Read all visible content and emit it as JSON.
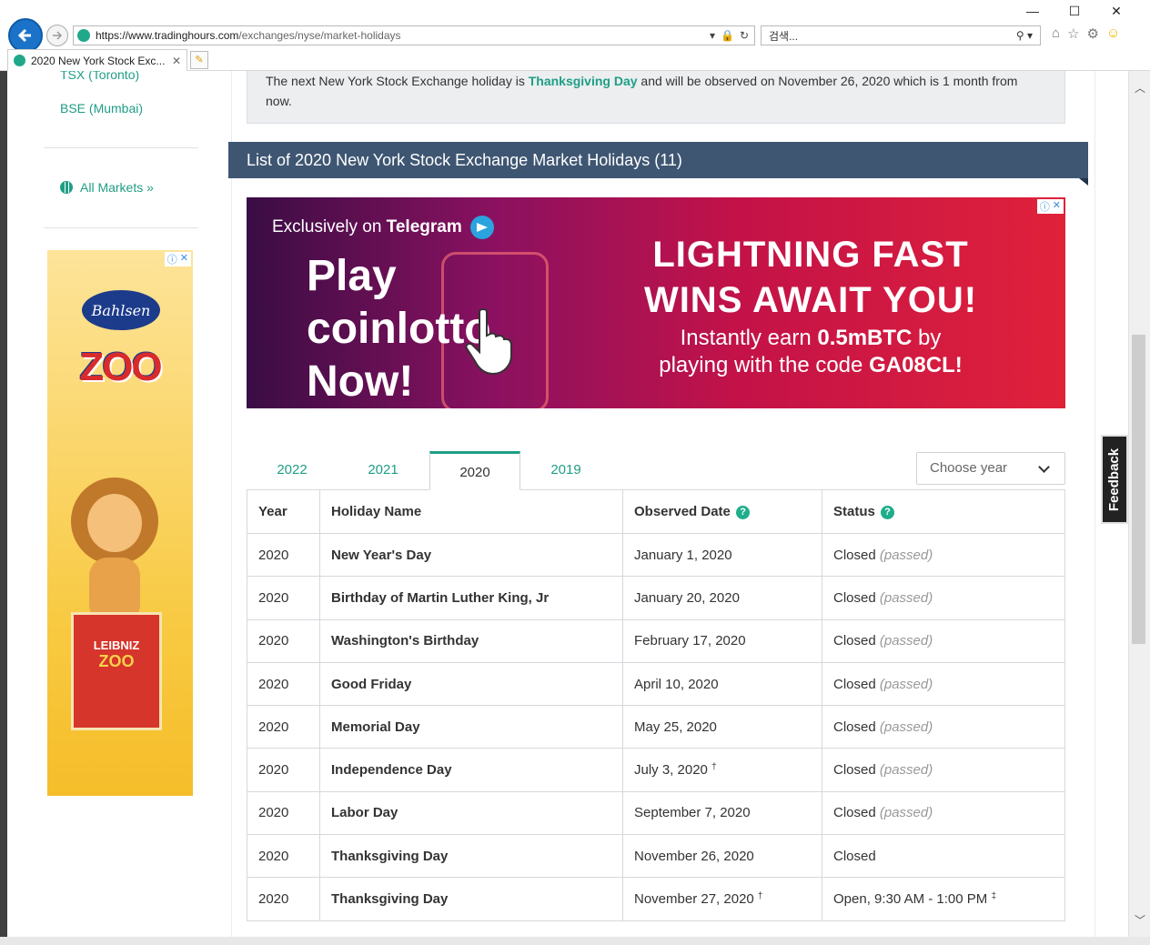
{
  "browser": {
    "url_host": "https://www.tradinghours.com",
    "url_path": "/exchanges/nyse/market-holidays",
    "search_placeholder": "검색...",
    "tab_title": "2020 New York Stock Exc...",
    "tab_close": "✕"
  },
  "sidebar": {
    "links": [
      "TSX (Toronto)",
      "BSE (Mumbai)"
    ],
    "all_markets": "All Markets »"
  },
  "ads": {
    "vertical": {
      "brand": "Bahlsen",
      "product": "ZOO",
      "box_brand": "LEIBNIZ",
      "box_product": "ZOO"
    },
    "banner": {
      "exclusive_prefix": "Exclusively on",
      "exclusive_brand": "Telegram",
      "play_line1": "Play",
      "play_line2": "coinlotto",
      "play_line3": "Now!",
      "headline_line1": "LIGHTNING FAST",
      "headline_line2": "WINS AWAIT YOU!",
      "sub_line1_prefix": "Instantly earn",
      "sub_line1_bold": "0.5mBTC",
      "sub_line1_suffix": "by",
      "sub_line2_prefix": "playing with the code",
      "sub_line2_bold": "GA08CL!"
    }
  },
  "notice": {
    "prefix": "The next New York Stock Exchange holiday is",
    "holiday": "Thanksgiving Day",
    "suffix": "and will be observed on November 26, 2020 which is 1 month from now."
  },
  "list_title": "List of 2020 New York Stock Exchange Market Holidays (11)",
  "year_tabs": [
    "2022",
    "2021",
    "2020",
    "2019"
  ],
  "year_select_placeholder": "Choose year",
  "table": {
    "headers": [
      "Year",
      "Holiday Name",
      "Observed Date",
      "Status"
    ],
    "rows": [
      {
        "year": "2020",
        "name": "New Year's Day",
        "date": "January 1, 2020",
        "date_mark": "",
        "status": "Closed",
        "note": "(passed)",
        "status_mark": ""
      },
      {
        "year": "2020",
        "name": "Birthday of Martin Luther King, Jr",
        "date": "January 20, 2020",
        "date_mark": "",
        "status": "Closed",
        "note": "(passed)",
        "status_mark": ""
      },
      {
        "year": "2020",
        "name": "Washington's Birthday",
        "date": "February 17, 2020",
        "date_mark": "",
        "status": "Closed",
        "note": "(passed)",
        "status_mark": ""
      },
      {
        "year": "2020",
        "name": "Good Friday",
        "date": "April 10, 2020",
        "date_mark": "",
        "status": "Closed",
        "note": "(passed)",
        "status_mark": ""
      },
      {
        "year": "2020",
        "name": "Memorial Day",
        "date": "May 25, 2020",
        "date_mark": "",
        "status": "Closed",
        "note": "(passed)",
        "status_mark": ""
      },
      {
        "year": "2020",
        "name": "Independence Day",
        "date": "July 3, 2020",
        "date_mark": "†",
        "status": "Closed",
        "note": "(passed)",
        "status_mark": ""
      },
      {
        "year": "2020",
        "name": "Labor Day",
        "date": "September 7, 2020",
        "date_mark": "",
        "status": "Closed",
        "note": "(passed)",
        "status_mark": ""
      },
      {
        "year": "2020",
        "name": "Thanksgiving Day",
        "date": "November 26, 2020",
        "date_mark": "",
        "status": "Closed",
        "note": "",
        "status_mark": ""
      },
      {
        "year": "2020",
        "name": "Thanksgiving Day",
        "date": "November 27, 2020",
        "date_mark": "†",
        "status": "Open, 9:30 AM - 1:00 PM",
        "note": "",
        "status_mark": "‡"
      }
    ]
  },
  "feedback_label": "Feedback",
  "colors": {
    "accent": "#1f9e86",
    "header_bar": "#3e5672",
    "back_button": "#1a73c8"
  }
}
